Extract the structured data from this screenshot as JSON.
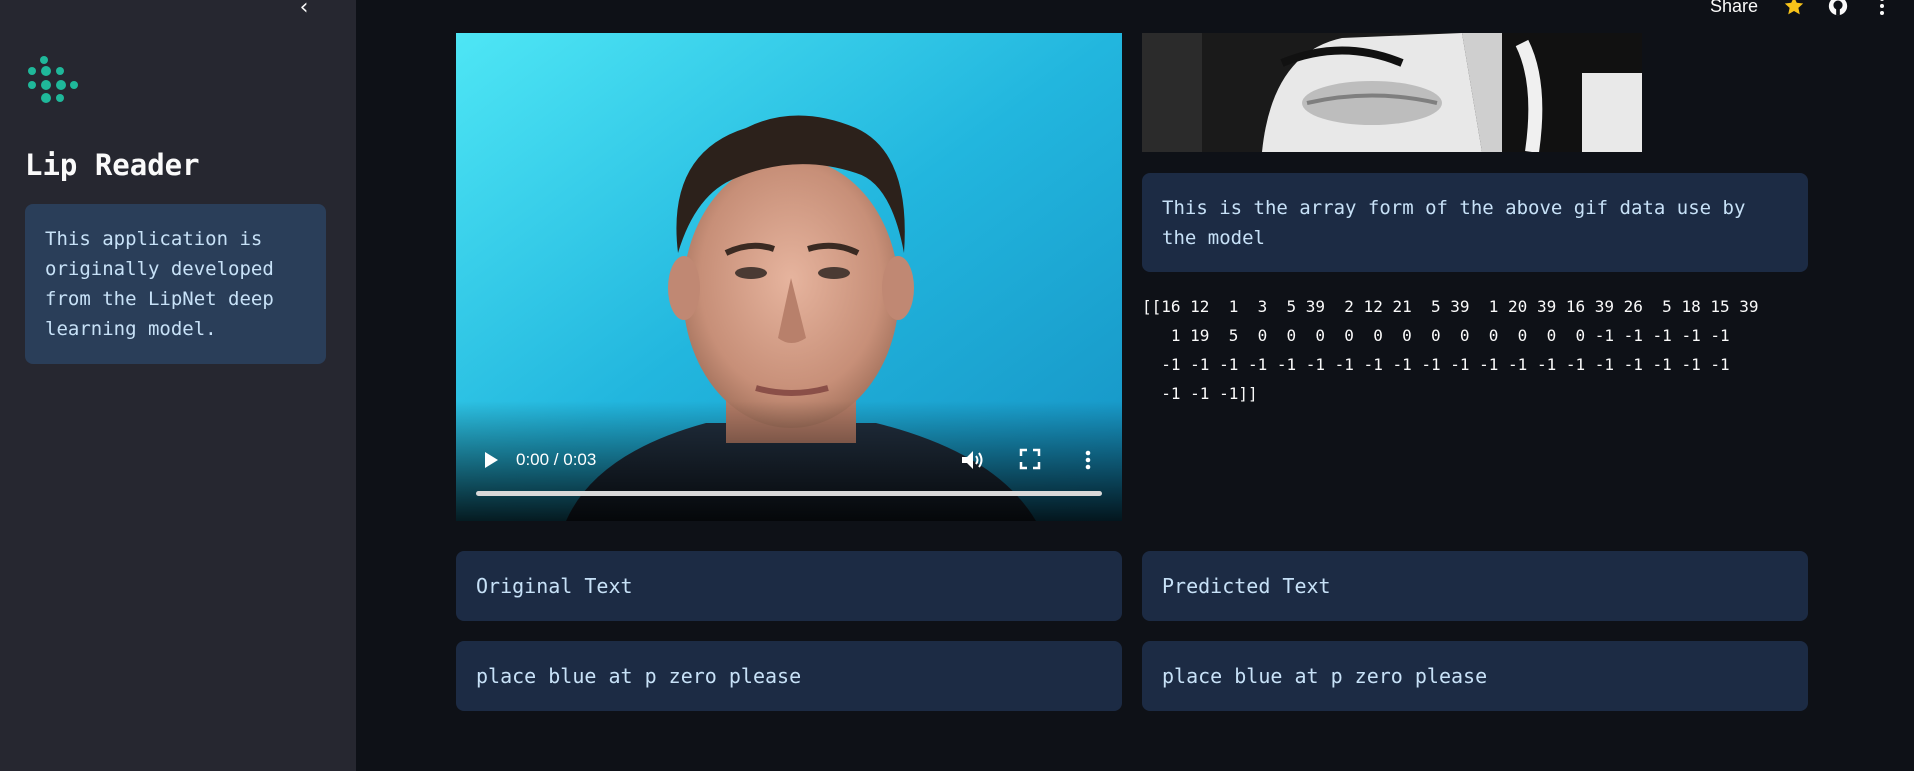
{
  "sidebar": {
    "title": "Lip Reader",
    "info": "This application is originally developed from the LipNet deep learning model.",
    "collapse_icon": "chevron-left-icon"
  },
  "header": {
    "share_label": "Share",
    "icons": [
      "star-icon",
      "github-icon",
      "more-vertical-icon"
    ]
  },
  "video": {
    "time_display": "0:00 / 0:03",
    "progress": 0
  },
  "array_section": {
    "description": "This is the array form of the above gif data use by the model",
    "array_lines": [
      "[[16 12  1  3  5 39  2 12 21  5 39  1 20 39 16 39 26  5 18 15 39",
      "   1 19  5  0  0  0  0  0  0  0  0  0  0  0  0 -1 -1 -1 -1 -1",
      "  -1 -1 -1 -1 -1 -1 -1 -1 -1 -1 -1 -1 -1 -1 -1 -1 -1 -1 -1 -1",
      "  -1 -1 -1]]"
    ]
  },
  "original": {
    "label": "Original Text",
    "value": "place blue at p zero please"
  },
  "predicted": {
    "label": "Predicted Text",
    "value": "place blue at p zero please"
  },
  "colors": {
    "background": "#0e1117",
    "sidebar": "#262730",
    "info_box": "#1c2b44",
    "info_text": "#c7e1f7",
    "accent": "#1fb89a",
    "star": "#f7c31a"
  }
}
